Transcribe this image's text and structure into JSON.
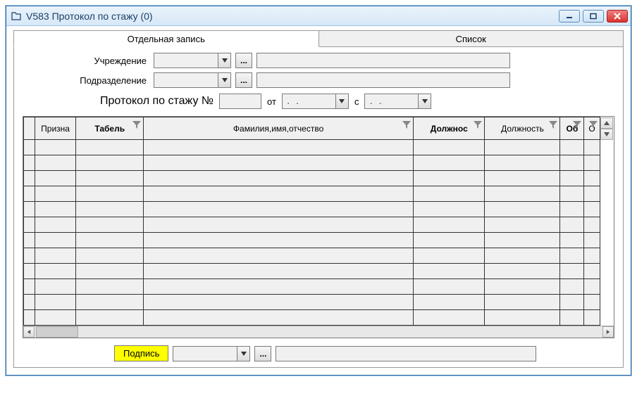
{
  "window": {
    "title": "V583 Протокол по стажу (0)"
  },
  "tabs": {
    "single": "Отдельная запись",
    "list": "Список"
  },
  "form": {
    "institution_label": "Учреждение",
    "department_label": "Подразделение",
    "institution_value": "",
    "department_value": "",
    "institution_text": "",
    "department_text": "",
    "ellipsis": "..."
  },
  "protocol": {
    "label": "Протокол по стажу №",
    "number": "",
    "from_label": "от",
    "with_label": "с",
    "date_from": ". .",
    "date_to": ". ."
  },
  "grid": {
    "columns": {
      "prizna": "Призна",
      "tabel": "Табель",
      "fio": "Фамилия,имя,отчество",
      "position_bold": "Должнос",
      "position": "Должность",
      "ob": "Об",
      "ot": "О"
    }
  },
  "footer": {
    "sign_label": "Подпись",
    "sign_value": "",
    "sign_text": "",
    "ellipsis": "..."
  }
}
